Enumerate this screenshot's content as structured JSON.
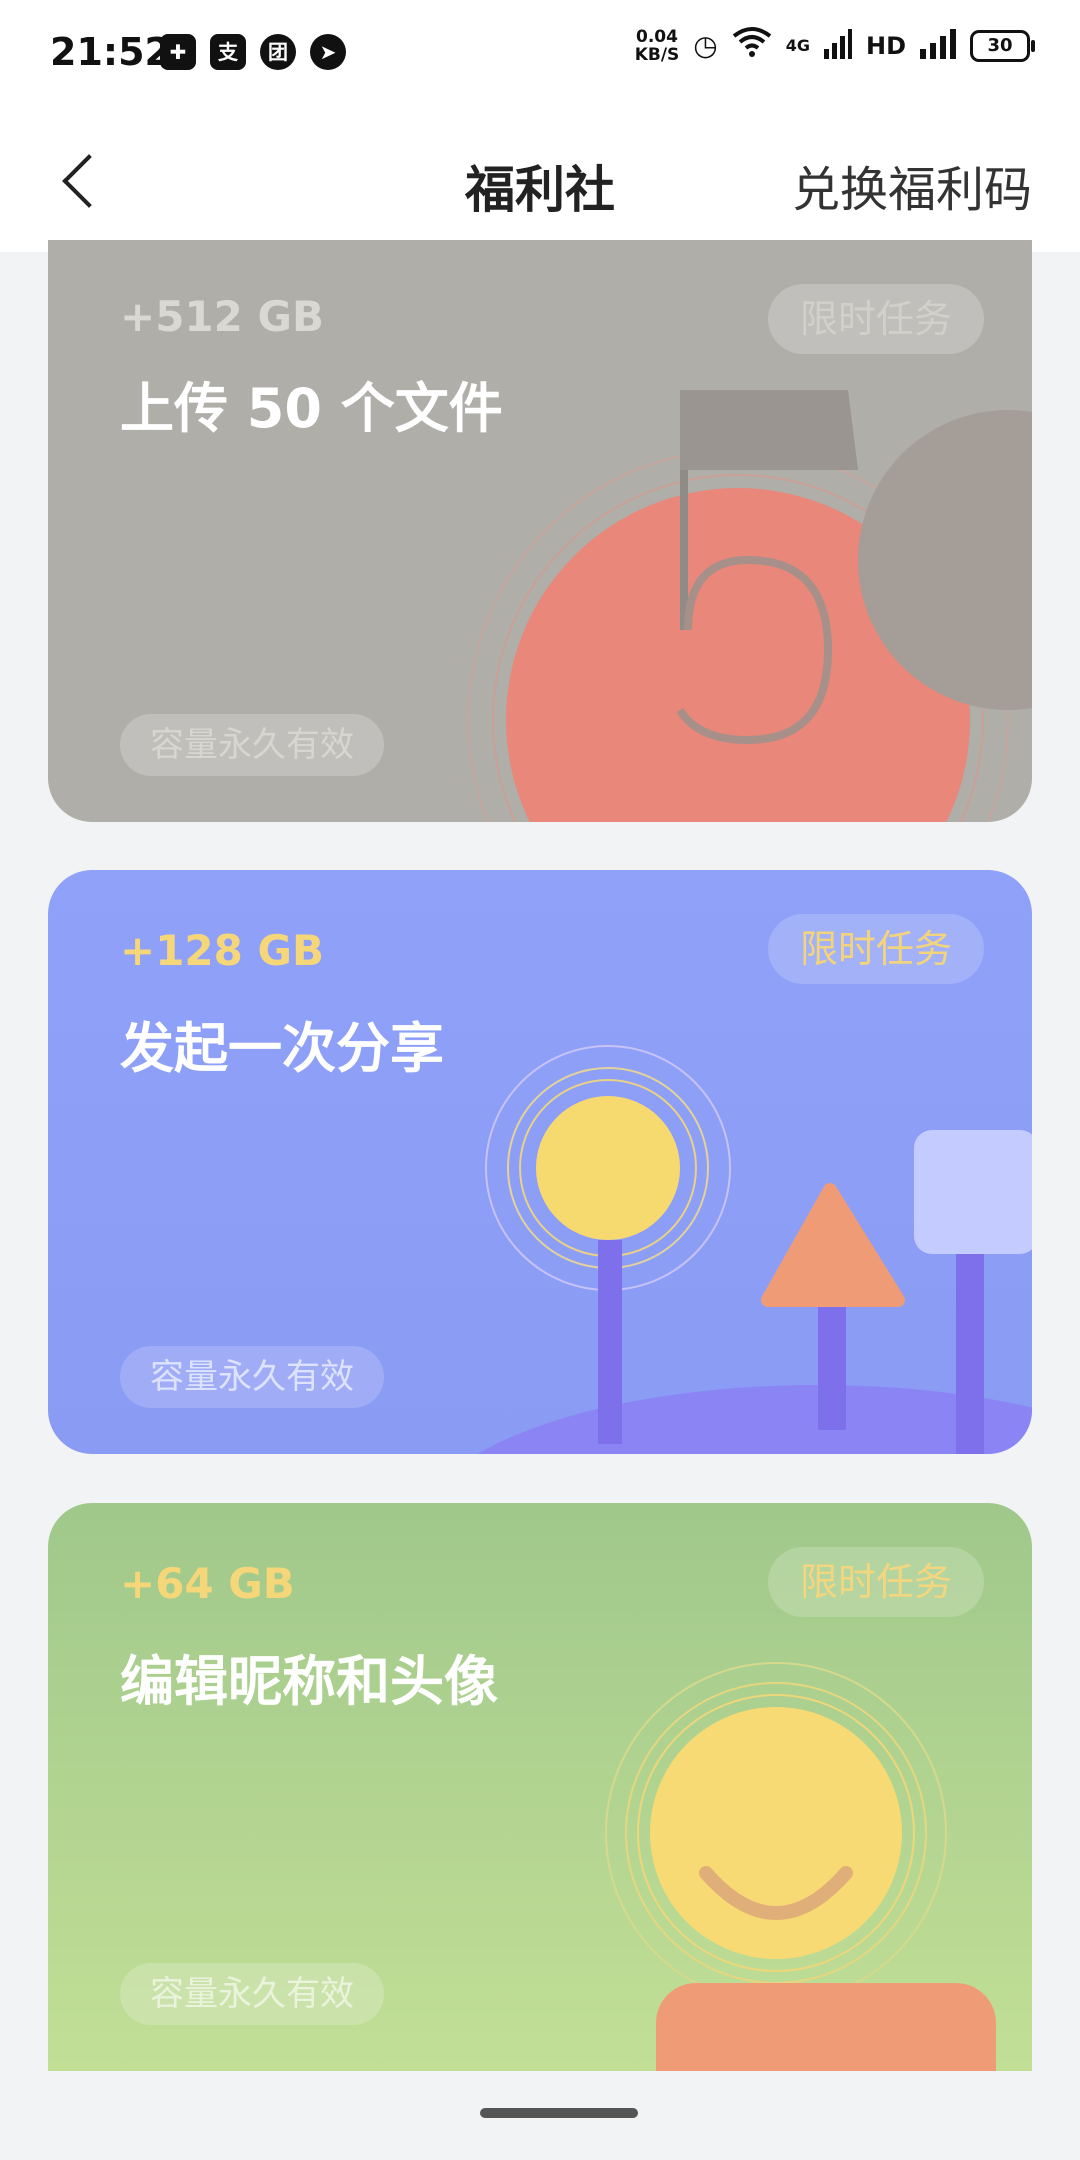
{
  "status_bar": {
    "time": "21:52",
    "left_icons": [
      "shield-icon",
      "alipay-icon",
      "meituan-icon",
      "direction-icon"
    ],
    "net_speed_value": "0.04",
    "net_speed_unit": "KB/S",
    "network": "4G",
    "hd": "HD",
    "battery": "30"
  },
  "nav": {
    "title": "福利社",
    "action": "兑换福利码"
  },
  "tasks": [
    {
      "reward": "+512 GB",
      "title": "上传 50 个文件",
      "badge": "限时任务",
      "validity": "容量永久有效",
      "illustration": "flag-fifty-illustration"
    },
    {
      "reward": "+128 GB",
      "title": "发起一次分享",
      "badge": "限时任务",
      "validity": "容量永久有效",
      "illustration": "share-shapes-illustration"
    },
    {
      "reward": "+64 GB",
      "title": "编辑昵称和头像",
      "badge": "限时任务",
      "validity": "容量永久有效",
      "illustration": "smiley-avatar-illustration"
    }
  ],
  "colors": {
    "card1": "#b0aea8",
    "card2": "#8fa1f8",
    "card3": "#a0c88b",
    "reward_yellow": "#f5d77a",
    "accent_red": "#e8877a",
    "accent_orange": "#ef9c76"
  }
}
